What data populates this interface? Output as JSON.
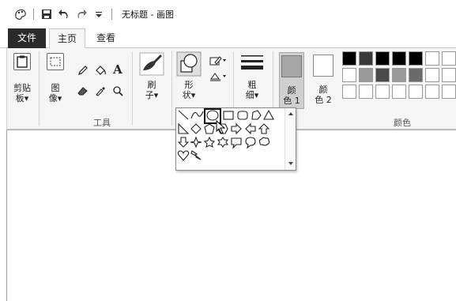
{
  "window": {
    "title": "无标题 - 画图"
  },
  "tabs": [
    {
      "label": "文件"
    },
    {
      "label": "主页"
    },
    {
      "label": "查看"
    }
  ],
  "ribbon": {
    "clipboard": {
      "label_line1": "剪贴",
      "label_line2": "板▾"
    },
    "image": {
      "label_line1": "图",
      "label_line2": "像▾"
    },
    "tools_group": "工具",
    "brushes": {
      "label_line1": "刷",
      "label_line2": "子▾"
    },
    "shapes": {
      "label_line1": "形",
      "label_line2": "状▾"
    },
    "size": {
      "label_line1": "粗",
      "label_line2": "细▾"
    },
    "color1": {
      "label_line1": "颜",
      "label_line2": "色 1",
      "value": "#a6a6a6"
    },
    "color2": {
      "label_line1": "颜",
      "label_line2": "色 2",
      "value": "#ffffff"
    },
    "colors_group": "颜色",
    "text_tool": "A"
  },
  "palette": {
    "row1": [
      "#000000",
      "#3a3a3a",
      "#000000",
      "#000000",
      "#000000",
      "#ffffff",
      "#ffffff",
      "#3a3a3a"
    ],
    "row2": [
      "#ffffff",
      "#9a9a9a",
      "#4a4a4a",
      "#9a9a9a",
      "#6a6a6a",
      "#ffffff",
      "#ffffff",
      "#ffffff"
    ],
    "row3": [
      "#ffffff",
      "#ffffff",
      "#ffffff",
      "#ffffff",
      "#ffffff",
      "#ffffff",
      "#ffffff",
      "#ffffff"
    ]
  },
  "shapes_dropdown": {
    "items": [
      "line",
      "curve",
      "oval",
      "rectangle",
      "rounded-rectangle",
      "polygon",
      "triangle",
      "right-triangle",
      "diamond",
      "pentagon",
      "hexagon",
      "right-arrow",
      "left-arrow",
      "up-arrow",
      "down-arrow",
      "four-point-star",
      "five-point-star",
      "six-point-star",
      "rounded-callout",
      "oval-callout",
      "cloud-callout",
      "heart",
      "lightning"
    ],
    "selected": "oval"
  }
}
